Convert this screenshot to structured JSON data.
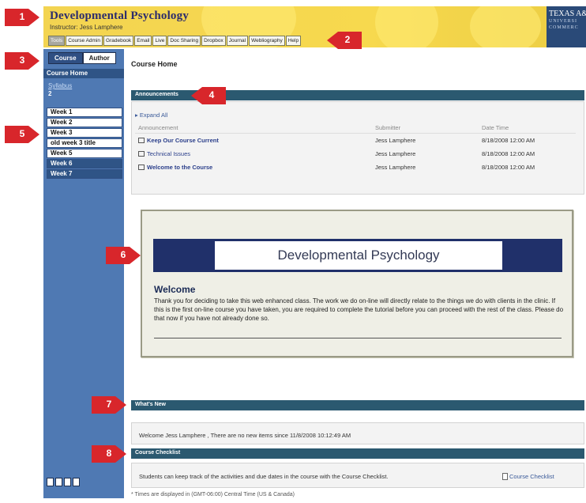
{
  "header": {
    "title": "Developmental Psychology",
    "instructor": "Instructor: Jess Lamphere",
    "tabs": [
      "Tools",
      "Course Admin",
      "Gradebook",
      "Email",
      "Live",
      "Doc Sharing",
      "Dropbox",
      "Journal",
      "Webliography",
      "Help"
    ],
    "logo_line1": "TEXAS A&",
    "logo_line2": "UNIVERSI",
    "logo_line3": "COMMERC"
  },
  "sidebar": {
    "course_label": "Course",
    "author_label": "Author",
    "section_header": "Course Home",
    "syllabus": "Syllabus",
    "number": "2",
    "weeks": [
      "Week 1",
      "Week 2",
      "Week 3",
      "old week 3 title",
      "Week 5",
      "Week 6",
      "Week 7"
    ]
  },
  "main": {
    "page_title": "Course Home",
    "announcements": {
      "header": "Announcements",
      "expand_all": "Expand All",
      "columns": [
        "Announcement",
        "Submitter",
        "Date Time"
      ],
      "rows": [
        {
          "title": "Keep Our Course Current",
          "submitter": "Jess Lamphere",
          "date": "8/18/2008 12:00 AM"
        },
        {
          "title": "Technical Issues",
          "submitter": "Jess Lamphere",
          "date": "8/18/2008 12:00 AM"
        },
        {
          "title": "Welcome to the Course",
          "submitter": "Jess Lamphere",
          "date": "8/18/2008 12:00 AM"
        }
      ]
    },
    "welcome": {
      "banner": "Developmental Psychology",
      "heading": "Welcome",
      "text": "Thank you for deciding to take this web enhanced class. The work we do on-line will directly relate to the things we do with clients in the clinic. If this is the first on-line course you have taken, you are required to complete the tutorial before you can proceed with the rest of the class. Please do that now if you have not already done so."
    },
    "whats_new": {
      "header": "What's New",
      "text": "Welcome Jess Lamphere , There are no new items since 11/8/2008 10:12:49 AM"
    },
    "checklist": {
      "header": "Course Checklist",
      "text": "Students can keep track of the activities and due dates in the course with the Course Checklist.",
      "link": "Course Checklist"
    },
    "footnote": "* Times are displayed in (GMT-06:00) Central Time (US & Canada)"
  },
  "callouts": [
    "1",
    "2",
    "3",
    "4",
    "5",
    "6",
    "7",
    "8"
  ],
  "colors": {
    "header_yellow": "#f3d451",
    "sidebar_blue": "#4f79b3",
    "section_bar": "#2b5970",
    "banner_navy": "#20306a",
    "callout_red": "#d8262b"
  }
}
